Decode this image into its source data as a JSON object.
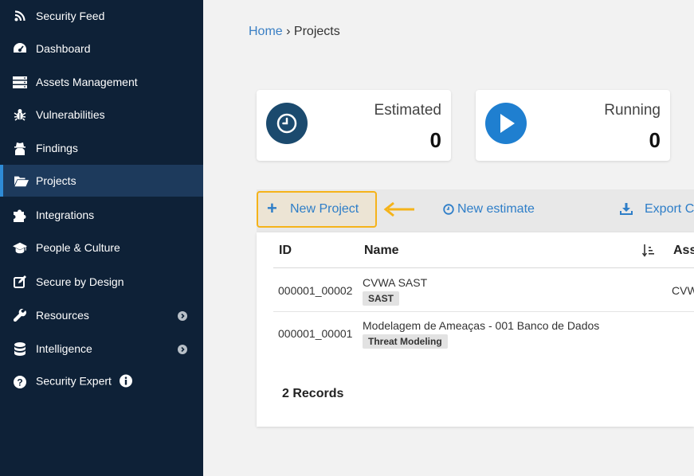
{
  "sidebar": {
    "items": [
      {
        "label": "Security Feed",
        "icon": "rss-icon"
      },
      {
        "label": "Dashboard",
        "icon": "dashboard-icon"
      },
      {
        "label": "Assets Management",
        "icon": "server-icon"
      },
      {
        "label": "Vulnerabilities",
        "icon": "bug-icon"
      },
      {
        "label": "Findings",
        "icon": "user-secret-icon"
      },
      {
        "label": "Projects",
        "icon": "folder-open-icon",
        "active": true
      },
      {
        "label": "Integrations",
        "icon": "puzzle-icon"
      },
      {
        "label": "People & Culture",
        "icon": "graduation-cap-icon"
      },
      {
        "label": "Secure by Design",
        "icon": "edit-icon"
      },
      {
        "label": "Resources",
        "icon": "wrench-icon",
        "has_submenu": true
      },
      {
        "label": "Intelligence",
        "icon": "database-icon",
        "has_submenu": true
      },
      {
        "label": "Security Expert",
        "icon": "question-circle-icon",
        "info_icon": "info-circle-icon"
      }
    ]
  },
  "breadcrumb": {
    "home": "Home",
    "separator": "›",
    "current": "Projects"
  },
  "cards": [
    {
      "title": "Estimated",
      "value": "0",
      "icon": "clock-icon",
      "color": "#1b4a6e"
    },
    {
      "title": "Running",
      "value": "0",
      "icon": "play-icon",
      "color": "#1f7fd0"
    }
  ],
  "toolbar": {
    "new_project": "New Project",
    "new_estimate": "New estimate",
    "export": "Export C",
    "highlight_color": "#f5b31a"
  },
  "table": {
    "headers": {
      "id": "ID",
      "name": "Name",
      "assets": "Ass"
    },
    "rows": [
      {
        "id": "000001_00002",
        "name": "CVWA SAST",
        "tag": "SAST",
        "asset": "CVW"
      },
      {
        "id": "000001_00001",
        "name": "Modelagem de Ameaças - 001 Banco de Dados",
        "tag": "Threat Modeling",
        "asset": ""
      }
    ],
    "records": "2 Records"
  }
}
